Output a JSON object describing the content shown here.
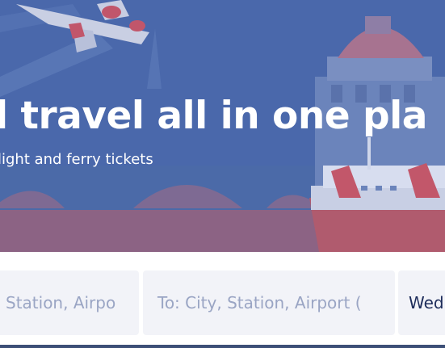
{
  "hero": {
    "headline": "l travel all in one pla",
    "subheadline": "light and ferry tickets"
  },
  "search": {
    "from_placeholder": "Station, Airpo",
    "to_placeholder": "To: City, Station, Airport (",
    "date_value": "Wed"
  },
  "colors": {
    "hero_overlay": "#3f5ea2",
    "field_background": "#f2f3f8",
    "placeholder_text": "#9aa5c4",
    "date_text": "#1d2c5a"
  }
}
